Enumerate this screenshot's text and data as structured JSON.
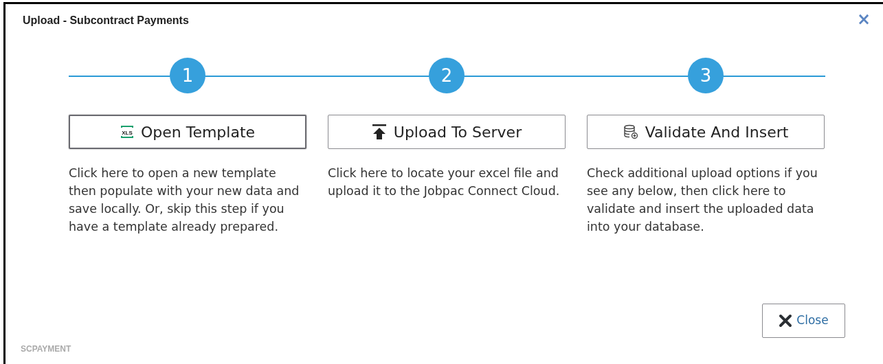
{
  "window": {
    "title": "Upload - Subcontract Payments",
    "close": "×"
  },
  "steps": [
    {
      "number": "1",
      "button": "Open Template",
      "kind": "spreadsheet",
      "icon_text": "XLS",
      "focused": true,
      "description": "Click here to open a new template then populate with your new data and save locally. Or, skip this step if you have a template already prepared."
    },
    {
      "number": "2",
      "button": "Upload To Server",
      "kind": "upload",
      "focused": false,
      "description": "Click here to locate your excel file and upload it to the Jobpac Connect Cloud."
    },
    {
      "number": "3",
      "button": "Validate And Insert",
      "kind": "database",
      "focused": false,
      "description": "Check additional upload options if you see any below, then click here to validate and insert the uploaded data into your database."
    }
  ],
  "close_button": "Close",
  "footer_code": "SCPAYMENT"
}
